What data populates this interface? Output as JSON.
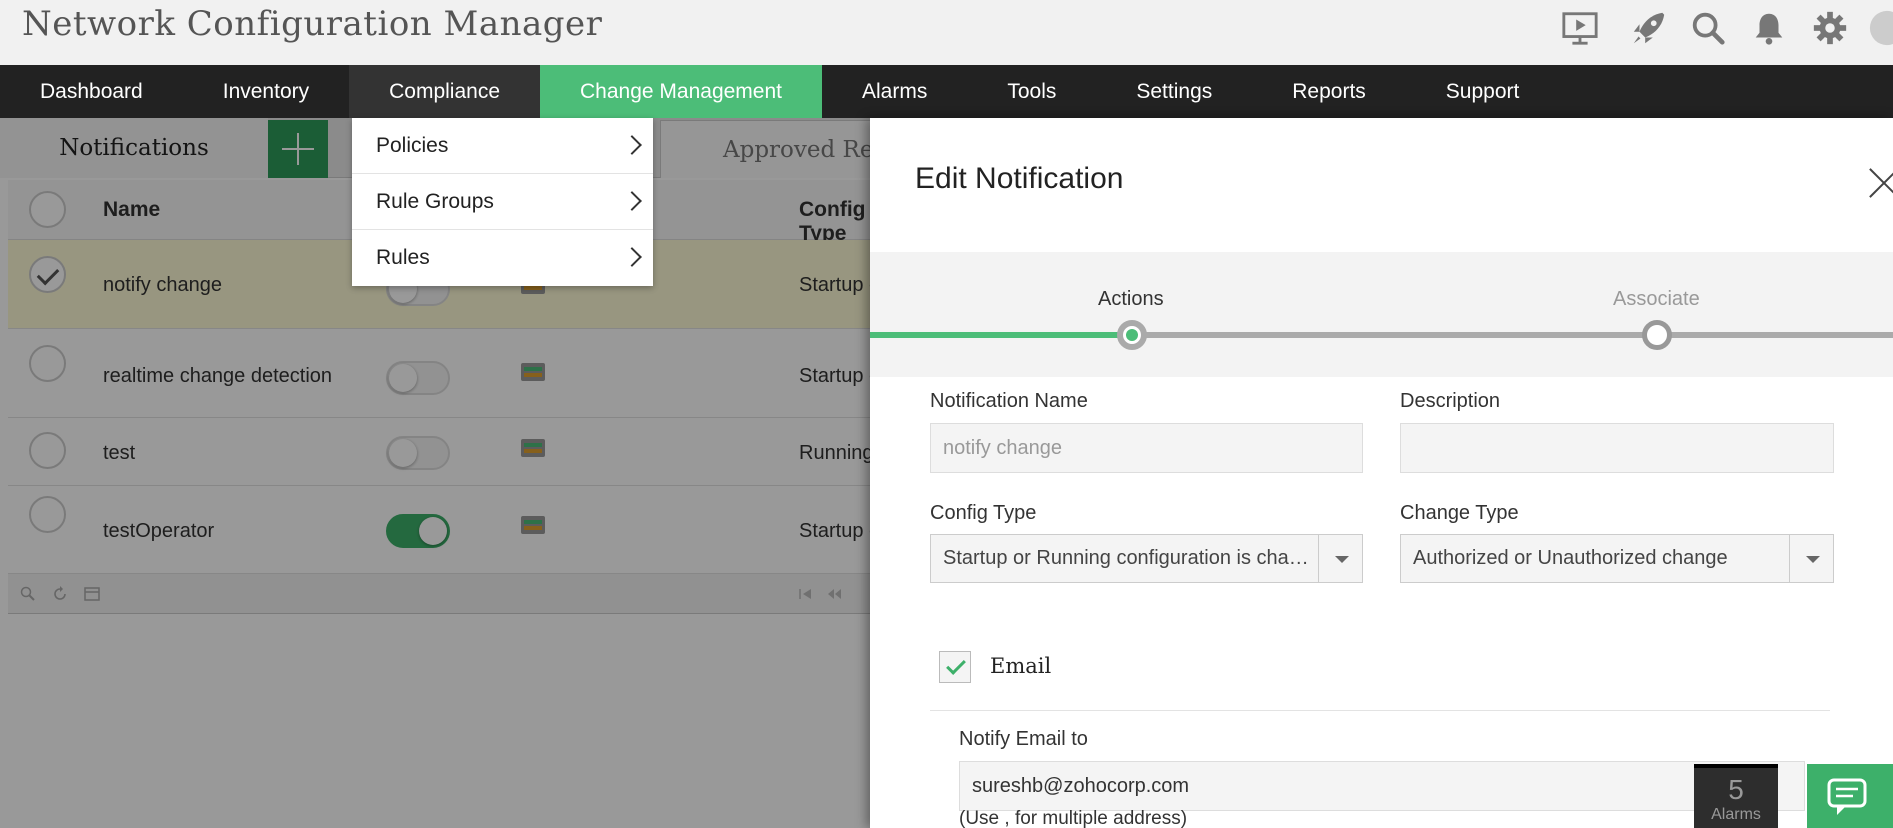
{
  "header": {
    "title": "Network Configuration Manager",
    "icons": [
      "presentation-icon",
      "rocket-icon",
      "search-icon",
      "bell-icon",
      "gear-icon",
      "user-icon"
    ]
  },
  "nav": {
    "items": [
      {
        "label": "Dashboard"
      },
      {
        "label": "Inventory"
      },
      {
        "label": "Compliance"
      },
      {
        "label": "Change Management"
      },
      {
        "label": "Alarms"
      },
      {
        "label": "Tools"
      },
      {
        "label": "Settings"
      },
      {
        "label": "Reports"
      },
      {
        "label": "Support"
      }
    ],
    "active": "Change Management",
    "hovered": "Compliance"
  },
  "compliance_menu": {
    "items": [
      {
        "label": "Policies"
      },
      {
        "label": "Rule Groups"
      },
      {
        "label": "Rules"
      }
    ]
  },
  "tabs": {
    "notifications": "Notifications",
    "approved": "Approved Requests"
  },
  "grid": {
    "columns": {
      "name": "Name",
      "config_type": "Config Type"
    },
    "rows": [
      {
        "name": "notify change",
        "enabled": false,
        "config": "Startup or Running configuration is changed",
        "selected": true
      },
      {
        "name": "realtime change detection",
        "enabled": false,
        "config": "Startup configuration is changed",
        "selected": false
      },
      {
        "name": "test",
        "enabled": false,
        "config": "Running configuration is changed",
        "selected": false
      },
      {
        "name": "testOperator",
        "enabled": true,
        "config": "Startup configuration is changed",
        "selected": false
      }
    ]
  },
  "edit_panel": {
    "title": "Edit Notification",
    "steps": [
      {
        "label": "Actions",
        "active": true
      },
      {
        "label": "Associate",
        "active": false
      }
    ],
    "fields": {
      "notification_name": {
        "label": "Notification Name",
        "value": "notify change"
      },
      "description": {
        "label": "Description",
        "value": ""
      },
      "config_type": {
        "label": "Config Type",
        "value": "Startup or Running configuration is changed"
      },
      "change_type": {
        "label": "Change Type",
        "value": "Authorized or Unauthorized change"
      }
    },
    "email": {
      "label": "Email",
      "checked": true,
      "notify_label": "Notify Email to",
      "value": "sureshb@zohocorp.com",
      "hint": "(Use , for multiple address)"
    }
  },
  "alarms": {
    "count": "5",
    "label": "Alarms"
  },
  "colors": {
    "accent": "#4cbd78",
    "nav_bg": "#222222",
    "header_bg": "#f1f1f1",
    "toggle_on": "#3db06a"
  }
}
